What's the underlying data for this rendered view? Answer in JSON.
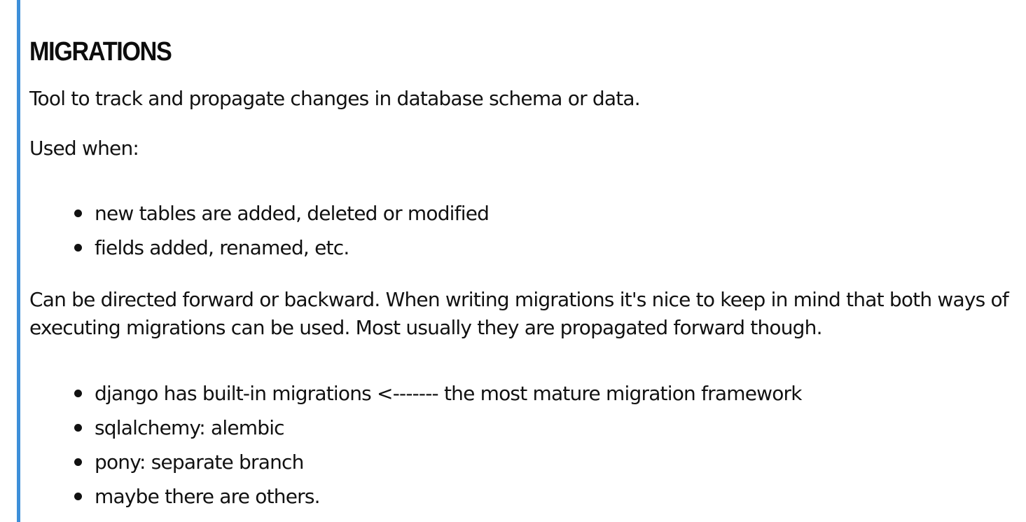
{
  "doc": {
    "title": "MIGRATIONS",
    "intro": "Tool to track and propagate changes in database schema or data.",
    "used_when": "Used when:",
    "list1": [
      "new tables are added, deleted or modified",
      "fields added, renamed, etc."
    ],
    "direction_line1": "Can be directed forward or backward. When writing migrations it's nice to keep in mind that both ways of",
    "direction_line2": "executing migrations can be used. Most usually they are propagated forward though.",
    "list2": [
      "django has built-in migrations <------- the most mature migration framework",
      "sqlalchemy: alembic",
      "pony: separate branch",
      "maybe there are others."
    ]
  },
  "colors": {
    "accent": "#3d8fd9",
    "text": "#111111"
  }
}
